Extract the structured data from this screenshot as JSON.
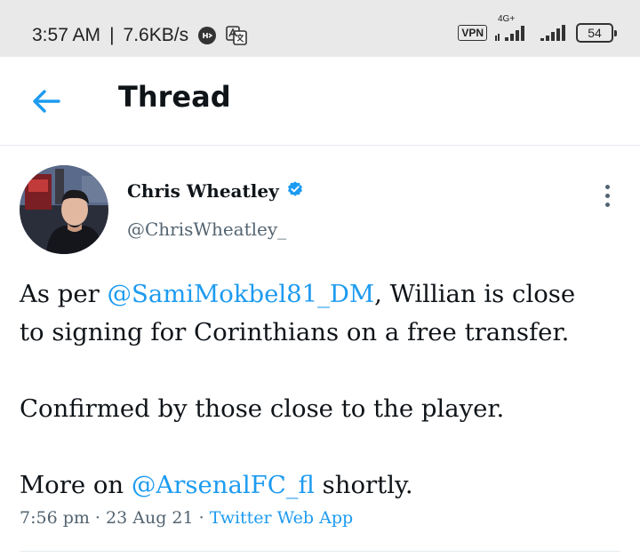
{
  "status_bar": {
    "time": "3:57 AM",
    "separator": "|",
    "speed": "7.6KB/s",
    "vpn": "VPN",
    "network": "4G+",
    "battery": "54"
  },
  "header": {
    "title": "Thread"
  },
  "tweet": {
    "author_name": "Chris Wheatley",
    "author_handle": "@ChrisWheatley_",
    "line1_pre": "As per ",
    "line1_mention": "@SamiMokbel81_DM",
    "line1_post": ", Willian is close",
    "line2": "to signing for Corinthians on a free transfer.",
    "line3": "Confirmed by those close to the player.",
    "line4_pre": "More on ",
    "line4_mention": "@ArsenalFC_fl",
    "line4_post": " shortly.",
    "time": "7:56 pm",
    "dot1": " · ",
    "date": "23 Aug 21",
    "dot2": " · ",
    "source": "Twitter Web App"
  },
  "colors": {
    "accent": "#1d9bf0",
    "text": "#0f1419",
    "secondary": "#536471",
    "statusbar_bg": "#e9e9e9"
  },
  "icons": {
    "back": "arrow-left-icon",
    "verified": "verified-badge-icon",
    "more": "more-vertical-icon"
  }
}
